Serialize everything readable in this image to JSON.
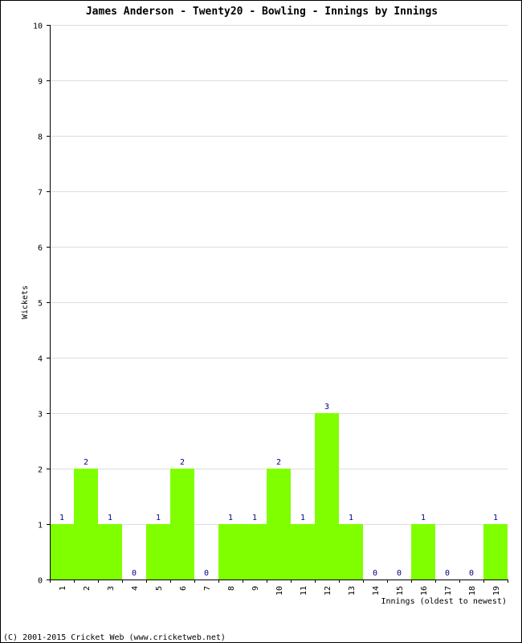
{
  "chart_data": {
    "type": "bar",
    "title": "James Anderson - Twenty20 - Bowling - Innings by Innings",
    "xlabel": "Innings (oldest to newest)",
    "ylabel": "Wickets",
    "ylim": [
      0,
      10
    ],
    "yticks": [
      "0",
      "1",
      "2",
      "3",
      "4",
      "5",
      "6",
      "7",
      "8",
      "9",
      "10"
    ],
    "grid": true,
    "categories": [
      "1",
      "2",
      "3",
      "4",
      "5",
      "6",
      "7",
      "8",
      "9",
      "10",
      "11",
      "12",
      "13",
      "14",
      "15",
      "16",
      "17",
      "18",
      "19"
    ],
    "values": [
      1,
      2,
      1,
      0,
      1,
      2,
      0,
      1,
      1,
      2,
      1,
      3,
      1,
      0,
      0,
      1,
      0,
      0,
      1
    ],
    "bar_color": "#80ff00",
    "label_color": "#000080",
    "grid_color": "#dddddd"
  },
  "footer": "(C) 2001-2015 Cricket Web (www.cricketweb.net)"
}
